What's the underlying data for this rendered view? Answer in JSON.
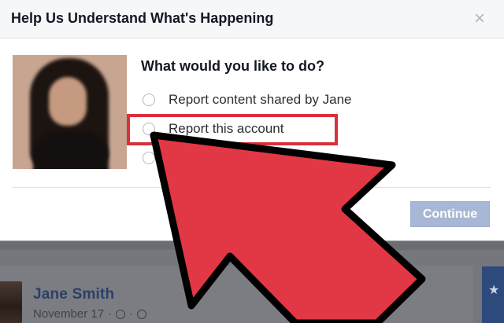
{
  "dialog": {
    "title": "Help Us Understand What's Happening",
    "close_glyph": "×",
    "question": "What would you like to do?",
    "options": [
      {
        "label": "Report content shared by Jane"
      },
      {
        "label": "Report this account"
      },
      {
        "label": ""
      }
    ],
    "continue_label": "Continue"
  },
  "post": {
    "author": "Jane Smith",
    "date": "November 17",
    "separator": "·"
  },
  "colors": {
    "highlight": "#d9303c",
    "arrow": "#e23744",
    "continue_bg": "#a7b7d5",
    "author_link": "#2b3f68"
  },
  "icons": {
    "close": "close-icon",
    "radio": "radio-button",
    "star": "star-icon",
    "clock": "clock-icon",
    "globe": "globe-icon"
  }
}
